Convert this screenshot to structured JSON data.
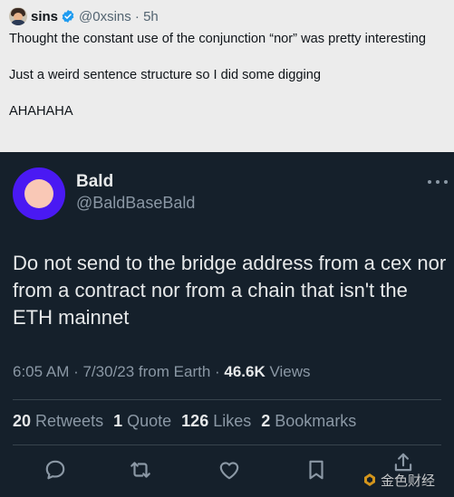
{
  "quote_tweet": {
    "author_name": "sins",
    "author_handle": "@0xsins · 5h",
    "text": "Thought the constant use of the conjunction “nor” was pretty interesting\n\nJust a weird sentence structure so I did some digging\n\nAHAHAHA"
  },
  "tweet": {
    "author_name": "Bald",
    "author_handle": "@BaldBaseBald",
    "text": "Do not send to the bridge address from a cex nor from a contract nor from a chain that isn't the ETH mainnet",
    "meta_time": "6:05 AM · 7/30/23 from Earth · ",
    "views_count": "46.6K",
    "views_label": " Views",
    "stats": {
      "retweets_count": "20",
      "retweets_label": " Retweets",
      "quotes_count": "1",
      "quotes_label": " Quote",
      "likes_count": "126",
      "likes_label": " Likes",
      "bookmarks_count": "2",
      "bookmarks_label": " Bookmarks"
    }
  },
  "icons": [
    "reply-icon",
    "retweet-icon",
    "like-icon",
    "bookmark-icon",
    "share-icon",
    "more-icon",
    "verified-icon"
  ],
  "colors": {
    "dark_background": "#15202b",
    "light_background": "#ececec",
    "avatar_purple": "#4a19f3",
    "verified_blue": "#1d9bf0",
    "secondary_text": "#8b98a5",
    "primary_text": "#e7e9ea"
  },
  "watermark": {
    "text": "金色财经"
  }
}
